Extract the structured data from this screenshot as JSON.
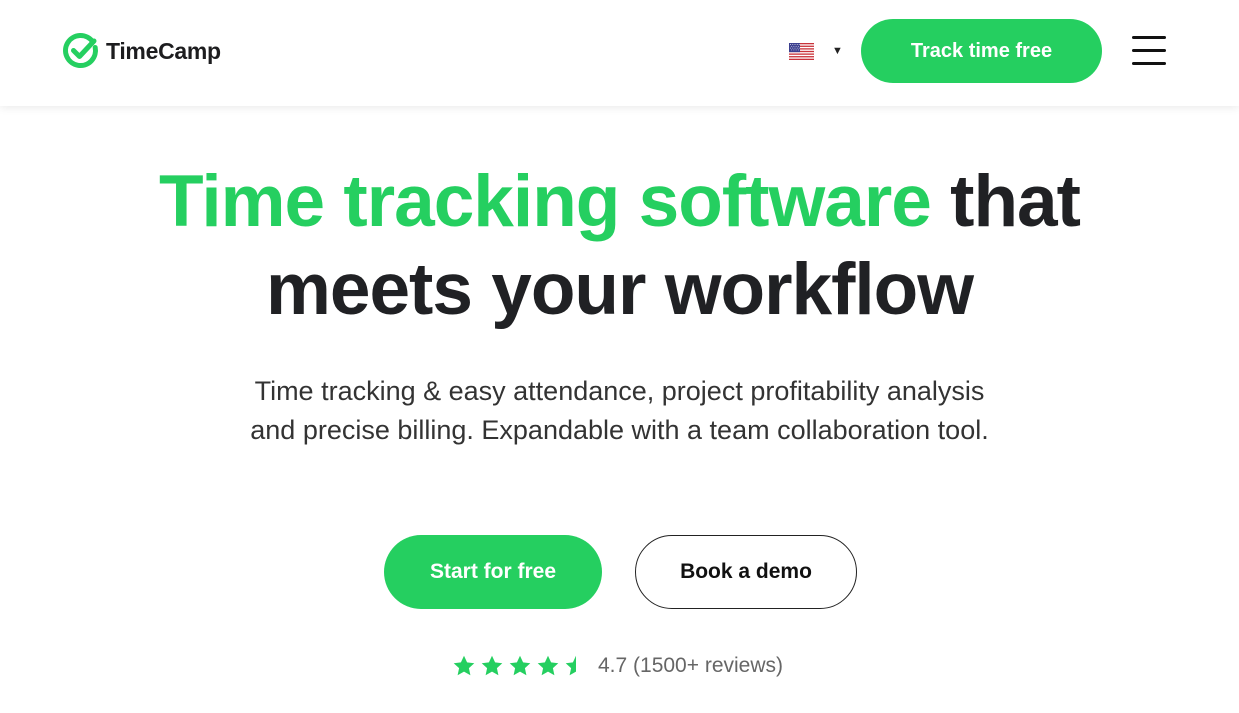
{
  "colors": {
    "brand_green": "#25cf60",
    "text_dark": "#202124",
    "text_muted": "#666666"
  },
  "header": {
    "logo_icon": "timecamp-check-icon",
    "logo_text": "TimeCamp",
    "language_icon": "us-flag-icon",
    "language_caret": "▼",
    "cta_label": "Track time free",
    "menu_icon": "hamburger-menu-icon"
  },
  "hero": {
    "title_highlight": "Time tracking software",
    "title_rest_line1": " that",
    "title_line2": "meets your workflow",
    "subtitle_line1": "Time tracking & easy attendance, project profitability analysis",
    "subtitle_line2": "and precise billing. Expandable with a team collaboration tool.",
    "primary_button": "Start for free",
    "secondary_button": "Book a demo"
  },
  "rating": {
    "stars_icon": "star-icon",
    "score": 4.7,
    "max": 5,
    "text": "4.7 (1500+ reviews)"
  }
}
